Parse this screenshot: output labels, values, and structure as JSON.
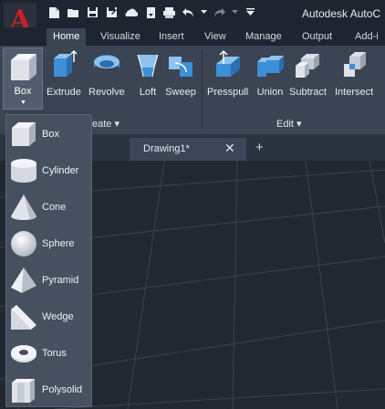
{
  "app": {
    "logo_letter": "A",
    "title": "Autodesk AutoC"
  },
  "quick_access": [
    "new-icon",
    "open-icon",
    "save-icon",
    "save-as-icon",
    "cloud-open-icon",
    "cloud-save-icon",
    "print-icon",
    "undo-icon",
    "redo-icon",
    "customize-icon"
  ],
  "ribbon_tabs": [
    {
      "label": "Home",
      "active": true
    },
    {
      "label": "Visualize"
    },
    {
      "label": "Insert"
    },
    {
      "label": "View"
    },
    {
      "label": "Manage"
    },
    {
      "label": "Output"
    },
    {
      "label": "Add-i"
    }
  ],
  "ribbon": {
    "box_label": "Box",
    "create_buttons": [
      "Extrude",
      "Revolve",
      "Loft",
      "Sweep"
    ],
    "edit_buttons": [
      "Presspull",
      "Union",
      "Subtract",
      "Intersect"
    ],
    "create_panel_title": "eate ▾",
    "edit_panel_title": "Edit ▾"
  },
  "document": {
    "tab_name": "Drawing1*"
  },
  "dropdown_items": [
    {
      "label": "Box",
      "icon": "box-icon"
    },
    {
      "label": "Cylinder",
      "icon": "cylinder-icon"
    },
    {
      "label": "Cone",
      "icon": "cone-icon"
    },
    {
      "label": "Sphere",
      "icon": "sphere-icon"
    },
    {
      "label": "Pyramid",
      "icon": "pyramid-icon"
    },
    {
      "label": "Wedge",
      "icon": "wedge-icon"
    },
    {
      "label": "Torus",
      "icon": "torus-icon"
    },
    {
      "label": "Polysolid",
      "icon": "polysolid-icon"
    }
  ],
  "colors": {
    "accent_blue": "#3d8fd6",
    "logo_red": "#c8202a",
    "ribbon_bg": "#3b4453",
    "canvas_bg": "#212830"
  }
}
